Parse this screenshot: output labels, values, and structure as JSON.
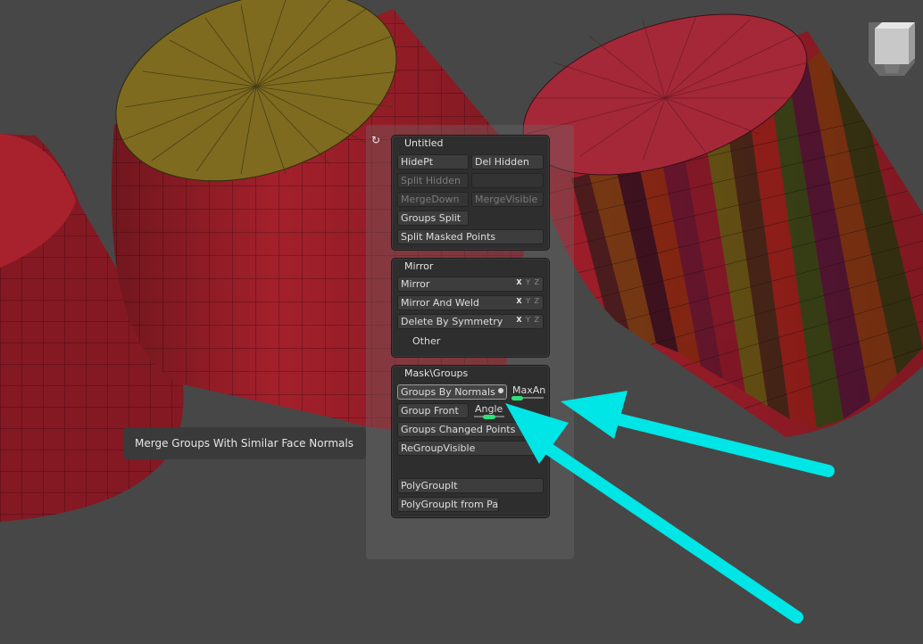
{
  "panels": {
    "untitled": {
      "title": "Untitled",
      "hide_pt": "HidePt",
      "del_hidden": "Del Hidden",
      "split_hidden": "Split Hidden",
      "merge_down": "MergeDown",
      "merge_visible": "MergeVisible",
      "groups_split": "Groups Split",
      "split_masked_points": "Split Masked Points"
    },
    "mirror": {
      "title": "Mirror",
      "mirror": "Mirror",
      "mirror_and_weld": "Mirror And Weld",
      "delete_by_symmetry": "Delete By Symmetry",
      "other": "Other",
      "axis_x": "X",
      "axis_yz": "Y Z"
    },
    "mask_groups": {
      "title": "Mask\\Groups",
      "groups_by_normals": "Groups By Normals",
      "max_angle_label": "MaxAn",
      "max_angle_value": 0.2,
      "group_front": "Group Front",
      "angle_label": "Angle",
      "angle_value": 0.25,
      "groups_changed_points": "Groups Changed Points",
      "regroup_visible": "ReGroupVisible",
      "polygroupit": "PolyGroupIt",
      "polygroupit_from_paint": "PolyGroupIt from Pa"
    }
  },
  "tooltip": {
    "text": "Merge Groups With Similar Face Normals"
  },
  "icons": {
    "refresh": "refresh-icon",
    "navigation_cube": "navigation-cube-icon"
  },
  "colors": {
    "background": "#474747",
    "cylinder_red": "#a01e2a",
    "cylinder_cap_yellow": "#7e6a1e",
    "slider_green": "#2ee07a",
    "annotation_arrow": "#00e5e5"
  }
}
